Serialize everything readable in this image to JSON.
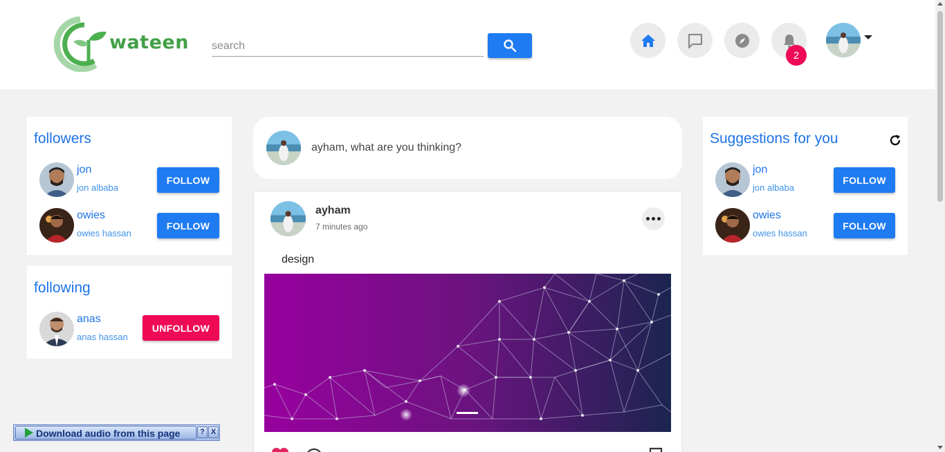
{
  "brand": {
    "name": "wateen"
  },
  "search": {
    "placeholder": "search"
  },
  "nav": {
    "items": [
      "home-icon",
      "chat-icon",
      "explore-icon",
      "bell-icon"
    ],
    "notification_count": "2",
    "accent": "#1e7bf2"
  },
  "followers": {
    "title": "followers",
    "people": [
      {
        "name": "jon",
        "handle": "jon albaba",
        "button": "FOLLOW"
      },
      {
        "name": "owies",
        "handle": "owies hassan",
        "button": "FOLLOW"
      }
    ]
  },
  "following": {
    "title": "following",
    "people": [
      {
        "name": "anas",
        "handle": "anas hassan",
        "button": "UNFOLLOW"
      }
    ]
  },
  "suggestions": {
    "title": "Suggestions for you",
    "people": [
      {
        "name": "jon",
        "handle": "jon albaba",
        "button": "FOLLOW"
      },
      {
        "name": "owies",
        "handle": "owies hassan",
        "button": "FOLLOW"
      }
    ]
  },
  "composer": {
    "prompt": "ayham, what are you thinking?"
  },
  "post": {
    "author": "ayham",
    "time": "7 minutes ago",
    "caption": "design"
  },
  "download_bar": {
    "label": "Download audio from this page",
    "help": "?",
    "close": "X"
  },
  "colors": {
    "primary": "#1e7bf2",
    "danger": "#ee0a55",
    "link": "#1e73e8",
    "brand_green": "#43a047"
  }
}
